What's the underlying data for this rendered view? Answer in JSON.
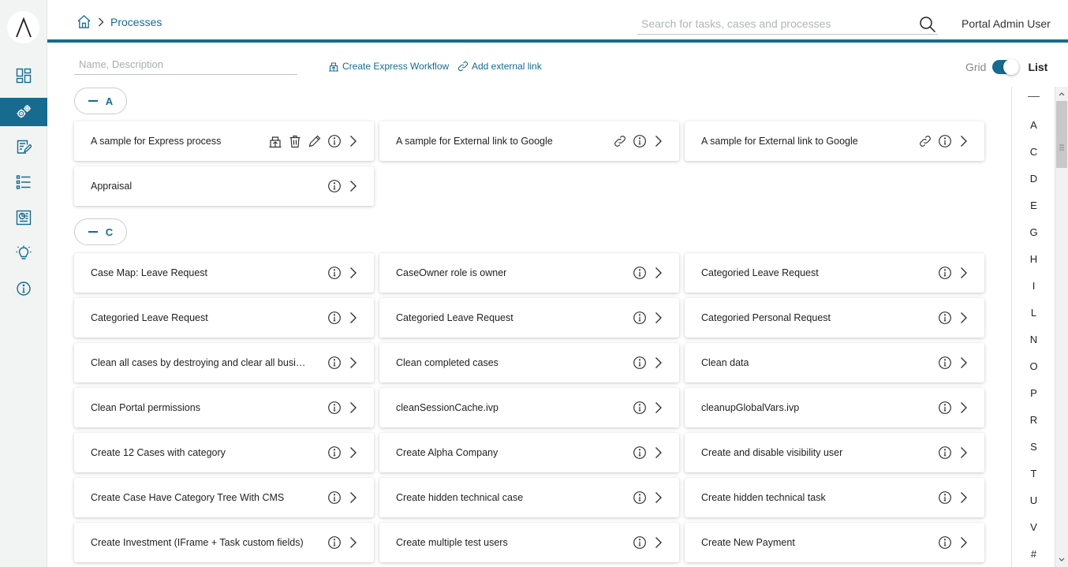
{
  "header": {
    "breadcrumb": "Processes",
    "search_placeholder": "Search for tasks, cases and processes",
    "user_name": "Portal Admin User"
  },
  "toolbar": {
    "filter_placeholder": "Name, Description",
    "create_express_label": "Create Express Workflow",
    "add_external_label": "Add external link",
    "grid_label": "Grid",
    "list_label": "List",
    "view_mode": "List"
  },
  "groups": [
    {
      "letter": "A",
      "processes": [
        {
          "name": "A sample for Express process",
          "icons": [
            "express-icon",
            "delete-icon",
            "edit-icon",
            "info-icon"
          ]
        },
        {
          "name": "A sample for External link to Google",
          "icons": [
            "link-icon",
            "info-icon"
          ]
        },
        {
          "name": "A sample for External link to Google",
          "icons": [
            "link-icon",
            "info-icon"
          ]
        },
        {
          "name": "Appraisal",
          "icons": [
            "info-icon"
          ]
        }
      ]
    },
    {
      "letter": "C",
      "processes": [
        {
          "name": "Case Map: Leave Request",
          "icons": [
            "info-icon"
          ]
        },
        {
          "name": "CaseOwner role is owner",
          "icons": [
            "info-icon"
          ]
        },
        {
          "name": "Categoried Leave Request",
          "icons": [
            "info-icon"
          ]
        },
        {
          "name": "Categoried Leave Request",
          "icons": [
            "info-icon"
          ]
        },
        {
          "name": "Categoried Leave Request",
          "icons": [
            "info-icon"
          ]
        },
        {
          "name": "Categoried Personal Request",
          "icons": [
            "info-icon"
          ]
        },
        {
          "name": "Clean all cases by destroying and clear all busines...",
          "icons": [
            "info-icon"
          ]
        },
        {
          "name": "Clean completed cases",
          "icons": [
            "info-icon"
          ]
        },
        {
          "name": "Clean data",
          "icons": [
            "info-icon"
          ]
        },
        {
          "name": "Clean Portal permissions",
          "icons": [
            "info-icon"
          ]
        },
        {
          "name": "cleanSessionCache.ivp",
          "icons": [
            "info-icon"
          ]
        },
        {
          "name": "cleanupGlobalVars.ivp",
          "icons": [
            "info-icon"
          ]
        },
        {
          "name": "Create 12 Cases with category",
          "icons": [
            "info-icon"
          ]
        },
        {
          "name": "Create Alpha Company",
          "icons": [
            "info-icon"
          ]
        },
        {
          "name": "Create and disable visibility user",
          "icons": [
            "info-icon"
          ]
        },
        {
          "name": "Create Case Have Category Tree With CMS",
          "icons": [
            "info-icon"
          ]
        },
        {
          "name": "Create hidden technical case",
          "icons": [
            "info-icon"
          ]
        },
        {
          "name": "Create hidden technical task",
          "icons": [
            "info-icon"
          ]
        },
        {
          "name": "Create Investment (IFrame + Task custom fields)",
          "icons": [
            "info-icon"
          ]
        },
        {
          "name": "Create multiple test users",
          "icons": [
            "info-icon"
          ]
        },
        {
          "name": "Create New Payment",
          "icons": [
            "info-icon"
          ]
        }
      ]
    }
  ],
  "alphabet_index": [
    "A",
    "C",
    "D",
    "E",
    "G",
    "H",
    "I",
    "L",
    "N",
    "O",
    "P",
    "R",
    "S",
    "T",
    "U",
    "V",
    "#"
  ],
  "sidebar": {
    "items": [
      {
        "name": "dashboard-icon",
        "active": false
      },
      {
        "name": "processes-icon",
        "active": true
      },
      {
        "name": "tasks-icon",
        "active": false
      },
      {
        "name": "cases-icon",
        "active": false
      },
      {
        "name": "statistics-icon",
        "active": false
      },
      {
        "name": "ideas-icon",
        "active": false
      },
      {
        "name": "info-icon",
        "active": false
      }
    ]
  },
  "colors": {
    "accent": "#166b8f",
    "sidebar_bg": "#f2f4f3"
  }
}
